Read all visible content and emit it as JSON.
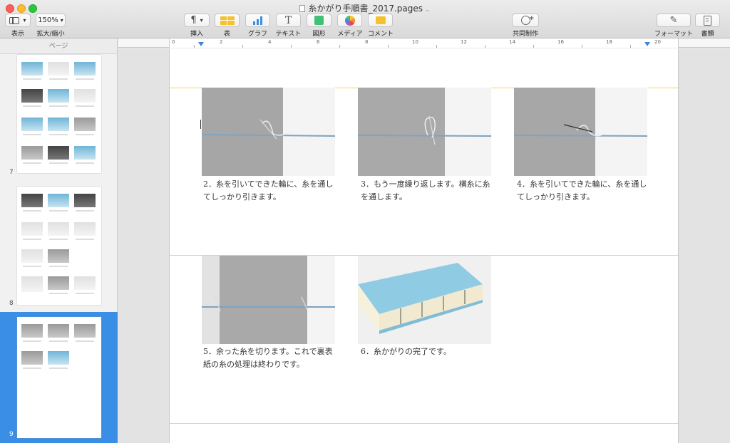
{
  "window": {
    "title": "糸かがり手順書_2017.pages"
  },
  "toolbar": {
    "view_label": "表示",
    "zoom_value": "150%",
    "zoom_label": "拡大/縮小",
    "insert_label": "挿入",
    "table_label": "表",
    "chart_label": "グラフ",
    "text_label": "テキスト",
    "shape_label": "図形",
    "media_label": "メディア",
    "comment_label": "コメント",
    "collab_label": "共同制作",
    "format_label": "フォーマット",
    "document_label": "書類",
    "insert_glyph": "¶",
    "text_glyph": "T"
  },
  "sidebar": {
    "header": "ページ",
    "pages": [
      {
        "number": "7"
      },
      {
        "number": "8"
      },
      {
        "number": "9",
        "selected": true
      }
    ]
  },
  "ruler": {
    "numbers": [
      "0",
      "2",
      "4",
      "6",
      "8",
      "10",
      "12",
      "14",
      "16",
      "18",
      "20"
    ]
  },
  "page": {
    "steps": [
      {
        "caption": "2．糸を引いてできた輪に、糸を通してしっかり引きます。"
      },
      {
        "caption": "3．もう一度繰り返します。横糸に糸を通します。"
      },
      {
        "caption": "4．糸を引いてできた輪に、糸を通してしっかり引きます。"
      },
      {
        "caption": "5．余った糸を切ります。これで裏表紙の糸の処理は終わりです。"
      },
      {
        "caption": "6．糸かがりの完了です。"
      }
    ]
  },
  "colors": {
    "accent": "#3a8ee6",
    "guide": "#eed66a"
  }
}
